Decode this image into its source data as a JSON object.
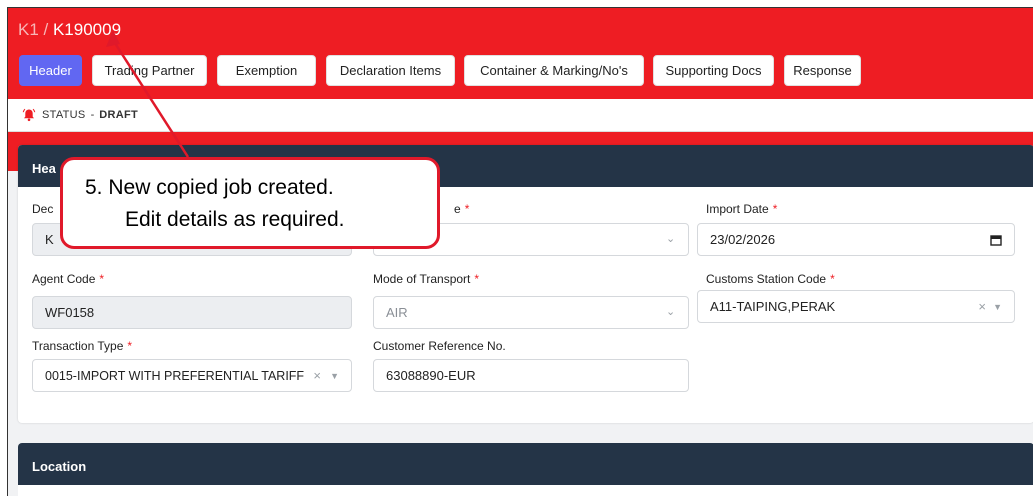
{
  "breadcrumb": {
    "parent": "K1",
    "separator": " / ",
    "current": "K190009"
  },
  "tabs": [
    {
      "label": "Header",
      "active": true
    },
    {
      "label": "Trading Partner",
      "active": false
    },
    {
      "label": "Exemption",
      "active": false
    },
    {
      "label": "Declaration Items",
      "active": false
    },
    {
      "label": "Container & Marking/No's",
      "active": false
    },
    {
      "label": "Supporting Docs",
      "active": false
    },
    {
      "label": "Response",
      "active": false
    }
  ],
  "status": {
    "label": "STATUS",
    "separator": "-",
    "value": "DRAFT",
    "icon": "alarm-bell-icon"
  },
  "header_card": {
    "title": "Hea",
    "fields": {
      "declaration": {
        "label": "Dec",
        "value": "K"
      },
      "type": {
        "label": "e",
        "required_mark": "*"
      },
      "import_date": {
        "label": "Import Date",
        "required_mark": "*",
        "value": "23/02/2026"
      },
      "agent_code": {
        "label": "Agent Code",
        "required_mark": "*",
        "value": "WF0158"
      },
      "mode_of_transport": {
        "label": "Mode of Transport",
        "required_mark": "*",
        "value": "AIR"
      },
      "customs_station_code": {
        "label": "Customs Station Code",
        "required_mark": "*",
        "value": "A11-TAIPING,PERAK"
      },
      "transaction_type": {
        "label": "Transaction Type",
        "required_mark": "*",
        "value": "0015-IMPORT WITH PREFERENTIAL TARIFF"
      },
      "customer_reference": {
        "label": "Customer Reference No.",
        "value": "63088890-EUR"
      }
    }
  },
  "location_card": {
    "title": "Location"
  },
  "annotation": {
    "line1": "5.  New copied job created.",
    "line2": "Edit details as required.",
    "color": "#e0192a"
  },
  "colors": {
    "brand_red": "#ee1d23",
    "active_tab": "#6167f2",
    "card_header": "#243447"
  }
}
